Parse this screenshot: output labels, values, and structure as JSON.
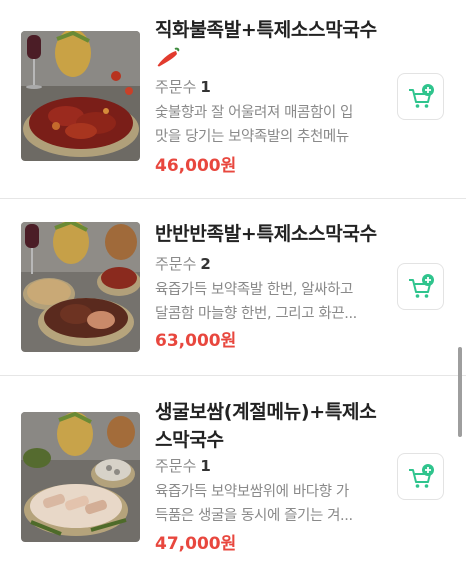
{
  "items": [
    {
      "name": "직화불족발+특제소스막국수",
      "spicy_icon": "chili-pepper-icon",
      "orders_label": "주문수",
      "orders_count": "1",
      "desc_line1": "숯불향과 잘 어울려져 매콤함이 입",
      "desc_line2": "맛을 당기는 보약족발의 추천메뉴",
      "price": "46,000원",
      "cart_icon": "add-to-cart-icon"
    },
    {
      "name": "반반반족발+특제소스막국수",
      "orders_label": "주문수",
      "orders_count": "2",
      "desc_line1": "육즙가득 보약족발 한번, 알싸하고",
      "desc_line2": "달콤함 마늘향 한번, 그리고 화끈...",
      "price": "63,000원",
      "cart_icon": "add-to-cart-icon"
    },
    {
      "name_line1": "생굴보쌈(계절메뉴)+특제소",
      "name_line2": "스막국수",
      "orders_label": "주문수",
      "orders_count": "1",
      "desc_line1": "육즙가득 보약보쌈위에 바다향 가",
      "desc_line2": "득품은 생굴을 동시에 즐기는 겨...",
      "price": "47,000원",
      "cart_icon": "add-to-cart-icon"
    }
  ],
  "colors": {
    "price": "#e8473e",
    "cart_green": "#2fc48d",
    "muted_text": "#8a8a8a"
  }
}
